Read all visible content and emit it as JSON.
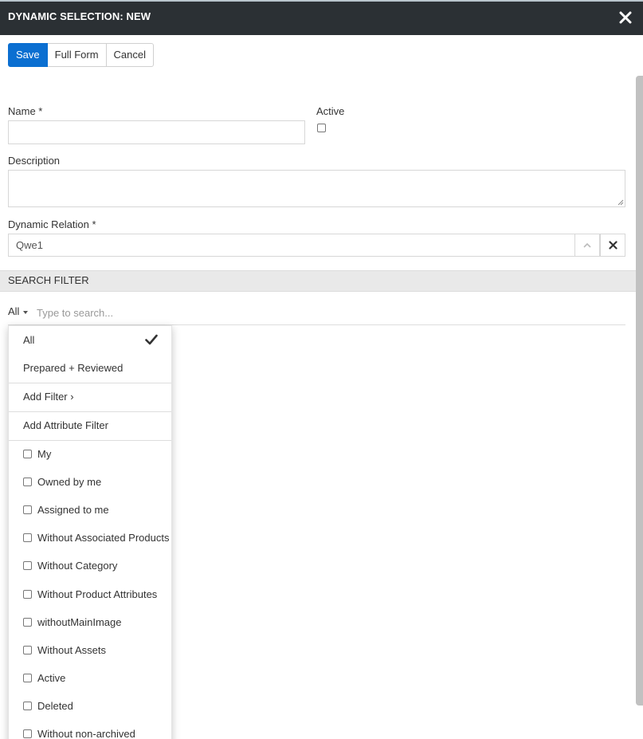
{
  "window": {
    "title": "DYNAMIC SELECTION: NEW",
    "close_icon": "close-icon"
  },
  "toolbar": {
    "save_label": "Save",
    "full_form_label": "Full Form",
    "cancel_label": "Cancel"
  },
  "form": {
    "name_label": "Name *",
    "name_value": "",
    "active_label": "Active",
    "active_checked": false,
    "description_label": "Description",
    "description_value": "",
    "relation_label": "Dynamic Relation *",
    "relation_value": "Qwe1"
  },
  "search_filter": {
    "section_title": "SEARCH FILTER",
    "filter_selected": "All",
    "search_placeholder": "Type to search..."
  },
  "dropdown": {
    "options": [
      {
        "label": "All",
        "selected": true
      },
      {
        "label": "Prepared + Reviewed",
        "selected": false
      }
    ],
    "add_filter_label": "Add Filter ›",
    "add_attribute_filter_label": "Add Attribute Filter",
    "checkbox_filters": [
      {
        "label": "My",
        "checked": false
      },
      {
        "label": "Owned by me",
        "checked": false
      },
      {
        "label": "Assigned to me",
        "checked": false
      },
      {
        "label": "Without Associated Products",
        "checked": false
      },
      {
        "label": "Without Category",
        "checked": false
      },
      {
        "label": "Without Product Attributes",
        "checked": false
      },
      {
        "label": "withoutMainImage",
        "checked": false
      },
      {
        "label": "Without Assets",
        "checked": false
      },
      {
        "label": "Active",
        "checked": false
      },
      {
        "label": "Deleted",
        "checked": false
      },
      {
        "label": "Without non-archived",
        "checked": false
      }
    ]
  },
  "colors": {
    "titlebar_bg": "#2b3034",
    "primary_button": "#0b6fd1",
    "section_bg": "#e9e9e9"
  }
}
